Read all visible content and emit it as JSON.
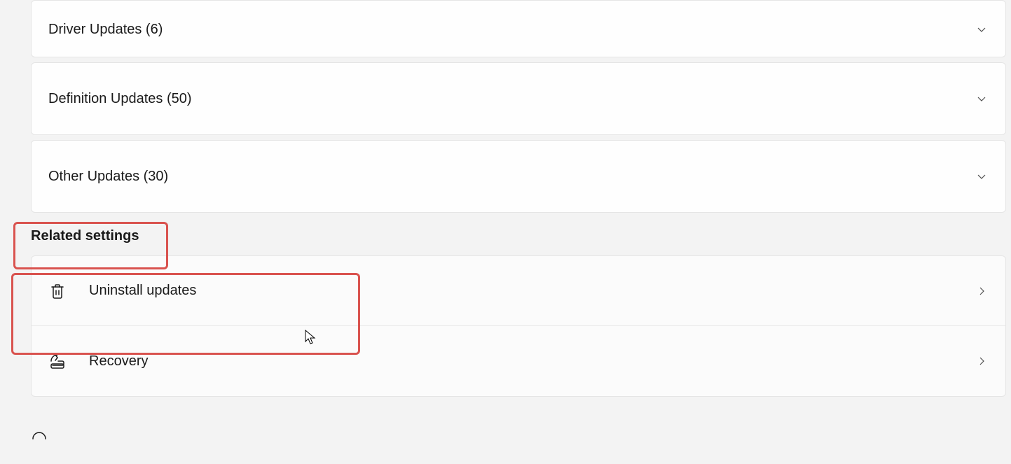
{
  "updates": {
    "driver": {
      "label": "Driver Updates (6)"
    },
    "definition": {
      "label": "Definition Updates (50)"
    },
    "other": {
      "label": "Other Updates (30)"
    }
  },
  "related": {
    "header": "Related settings",
    "uninstall": {
      "label": "Uninstall updates"
    },
    "recovery": {
      "label": "Recovery"
    }
  }
}
